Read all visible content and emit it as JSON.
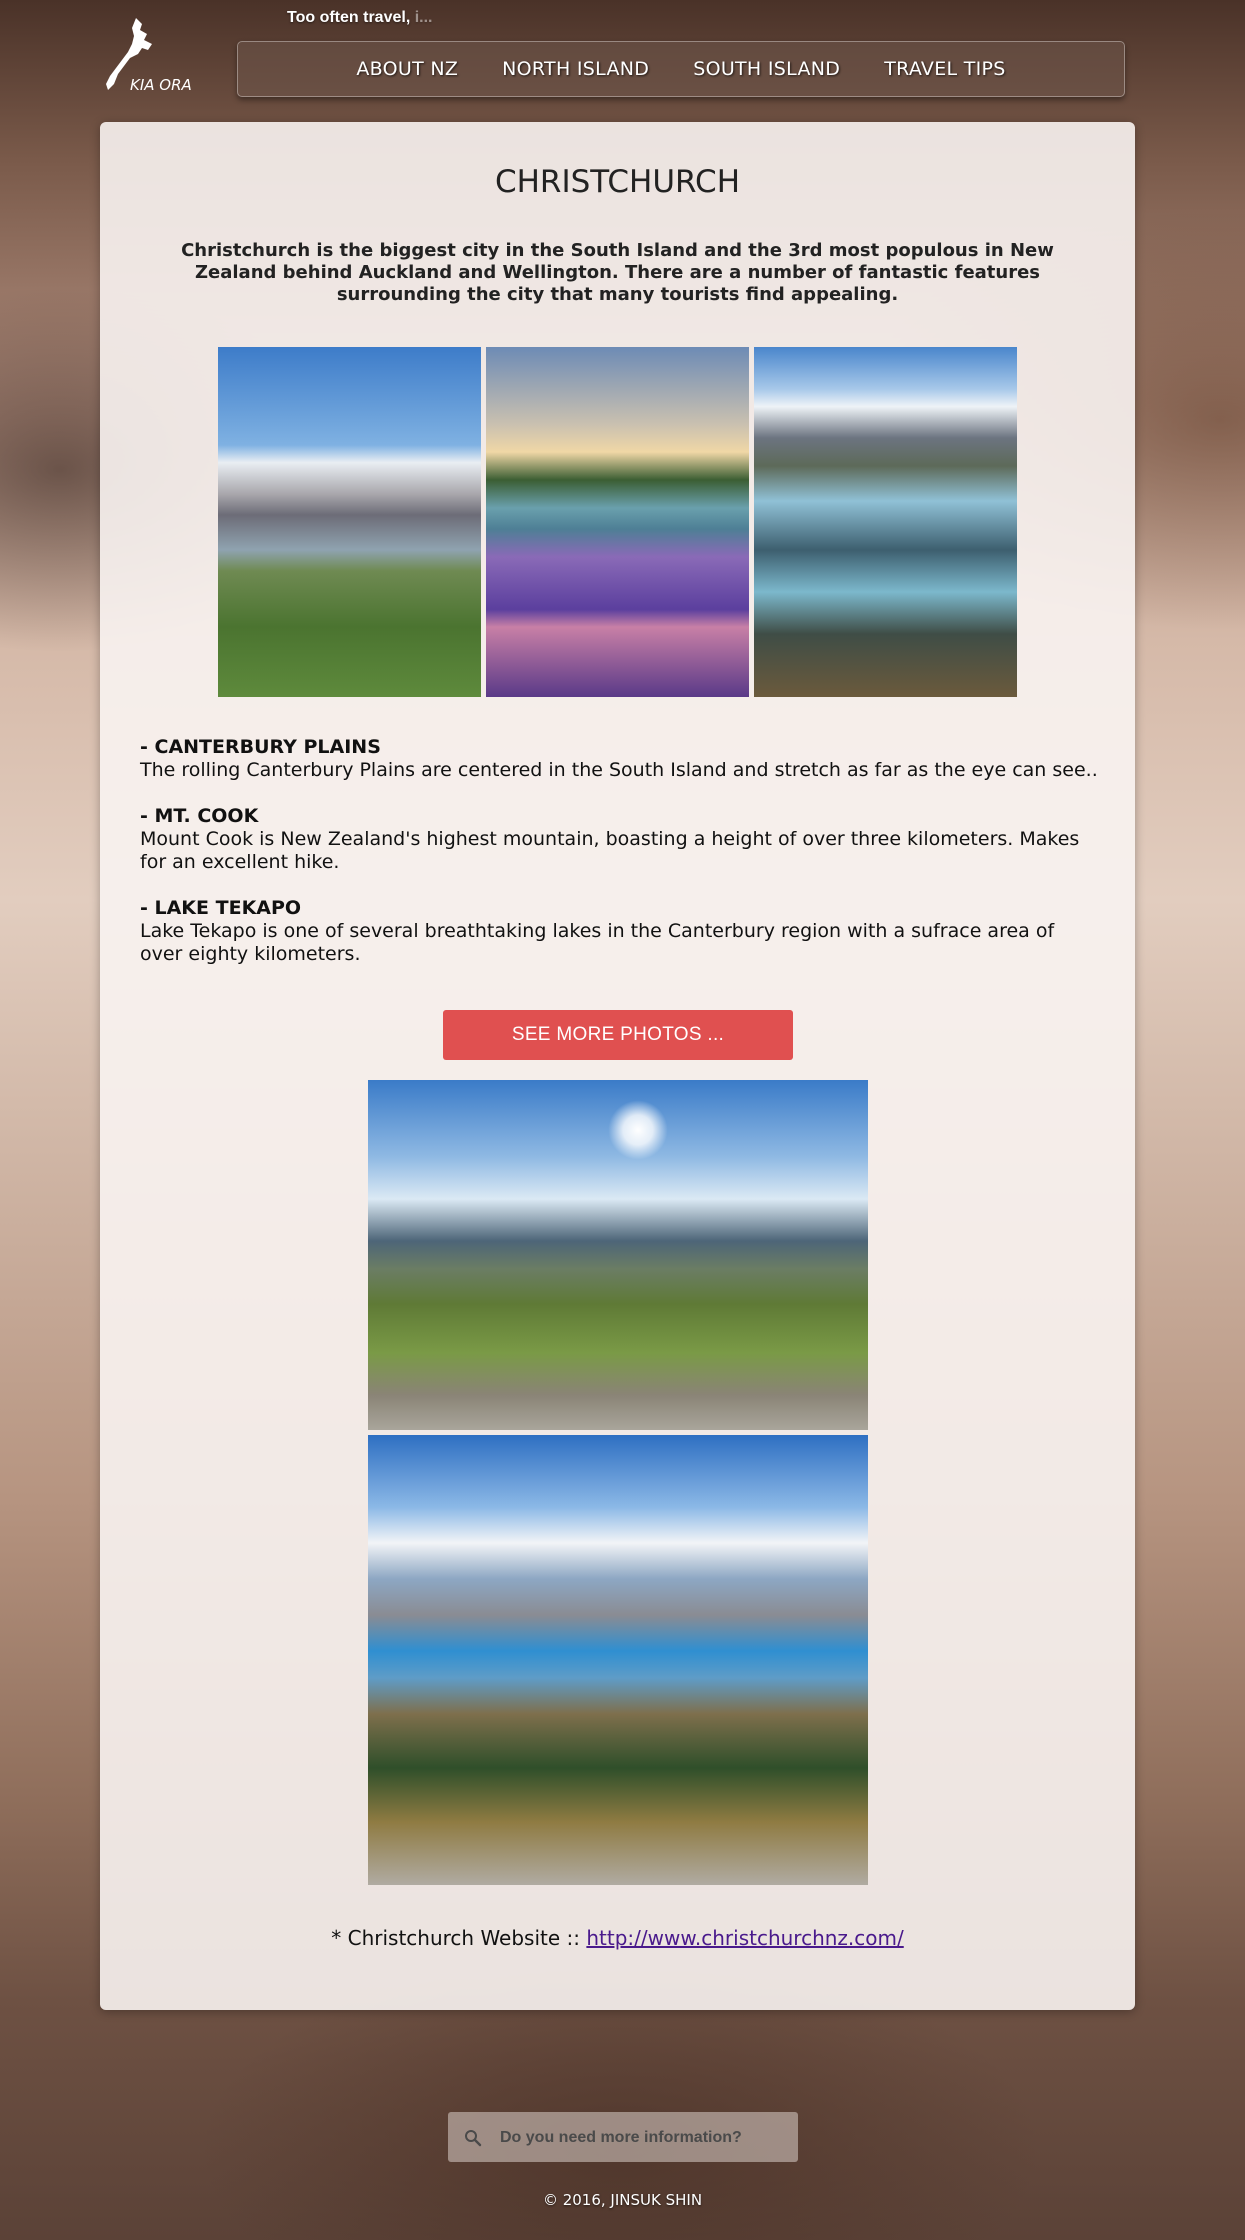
{
  "header": {
    "logo_text": "KIA ORA",
    "tagline": "Too often travel, ",
    "tagline_fade": "i..."
  },
  "nav": {
    "items": [
      {
        "label": "ABOUT NZ"
      },
      {
        "label": "NORTH ISLAND"
      },
      {
        "label": "SOUTH ISLAND"
      },
      {
        "label": "TRAVEL TIPS"
      }
    ]
  },
  "main": {
    "title": "CHRISTCHURCH",
    "intro": "Christchurch is the biggest city in the South Island and the 3rd most populous in New Zealand behind Auckland and Wellington. There are a number of fantastic features surrounding the city that many tourists find appealing.",
    "features": [
      {
        "heading": "- CANTERBURY PLAINS",
        "text": "The rolling Canterbury Plains are centered in the South Island and stretch as far as the eye can see.."
      },
      {
        "heading": "- MT. COOK",
        "text": "Mount Cook is New Zealand's highest mountain, boasting a height of over three kilometers. Makes for an excellent hike."
      },
      {
        "heading": "- LAKE TEKAPO",
        "text": "Lake Tekapo is one of several breathtaking lakes in the Canterbury region with a sufrace area of over eighty kilometers."
      }
    ],
    "more_photos_button": "SEE MORE PHOTOS ...",
    "website_label": "* Christchurch Website :: ",
    "website_link": "http://www.christchurchnz.com/"
  },
  "search": {
    "placeholder": "Do you need more information?"
  },
  "footer": {
    "copyright": "© 2016, JINSUK SHIN"
  },
  "colors": {
    "button": "#e05050",
    "link": "#4a1a8c",
    "text": "#222222"
  },
  "icons": {
    "logo": "new-zealand-map-icon",
    "search": "search-icon"
  }
}
